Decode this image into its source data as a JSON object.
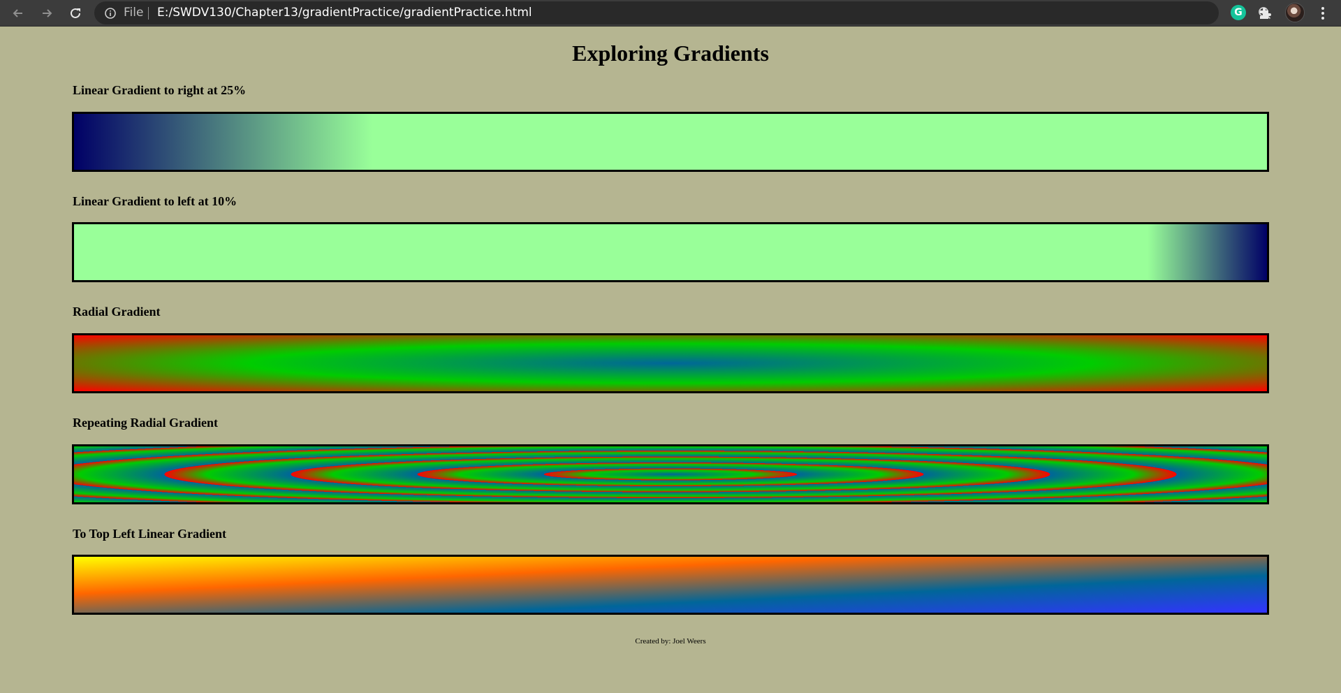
{
  "browser": {
    "scheme_label": "File",
    "url": "E:/SWDV130/Chapter13/gradientPractice/gradientPractice.html",
    "extension_badge": "G"
  },
  "page": {
    "title": "Exploring Gradients",
    "background": "#b5b591",
    "sections": [
      {
        "label": "Linear Gradient to right at 25%",
        "gradient": "linear-gradient(to right, #000066, #99ff99 25%)"
      },
      {
        "label": "Linear Gradient to left at 10%",
        "gradient": "linear-gradient(to left, #000066, #99ff99 10%)"
      },
      {
        "label": "Radial Gradient",
        "gradient": "radial-gradient(#006699, #00cc00, #ff0000)"
      },
      {
        "label": "Repeating Radial Gradient",
        "gradient": "repeating-radial-gradient(#006699, #00cc00 10%, #ff0000 15%)"
      },
      {
        "label": "To Top Left Linear Gradient",
        "gradient": "linear-gradient(to top left, #3333ff, #006699, #ff6600, #ffff00)"
      }
    ],
    "footer": "Created by: Joel Weers"
  }
}
